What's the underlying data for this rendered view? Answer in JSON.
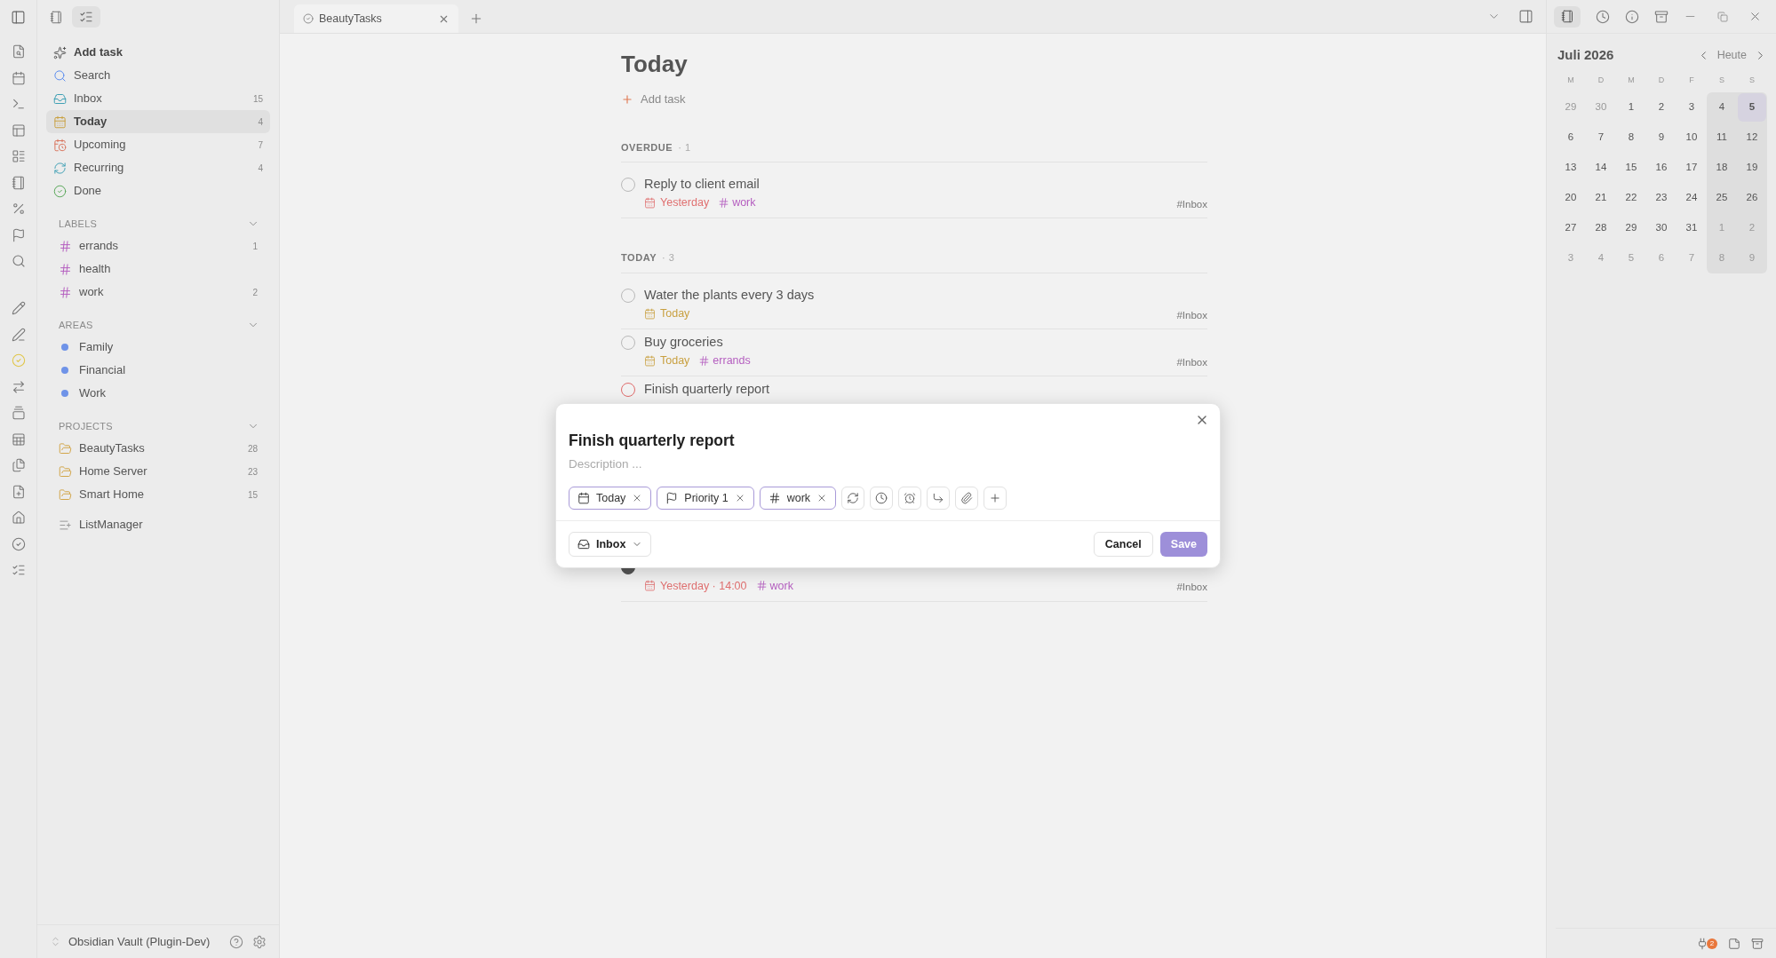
{
  "tab": {
    "title": "BeautyTasks"
  },
  "sidebar": {
    "actions": [
      {
        "label": "Add task",
        "bold": true,
        "selected": false
      },
      {
        "label": "Search",
        "bold": false,
        "selected": false
      },
      {
        "label": "Inbox",
        "count": "15",
        "bold": false,
        "selected": false
      },
      {
        "label": "Today",
        "count": "4",
        "bold": false,
        "selected": true
      },
      {
        "label": "Upcoming",
        "count": "7",
        "bold": false,
        "selected": false
      },
      {
        "label": "Recurring",
        "count": "4",
        "bold": false,
        "selected": false
      },
      {
        "label": "Done",
        "bold": false,
        "selected": false
      }
    ],
    "sections": [
      {
        "title": "LABELS",
        "kind": "label",
        "expanded": true,
        "items": [
          {
            "label": "errands",
            "count": "1"
          },
          {
            "label": "health"
          },
          {
            "label": "work",
            "count": "2"
          }
        ]
      },
      {
        "title": "AREAS",
        "kind": "area",
        "expanded": true,
        "items": [
          {
            "label": "Family"
          },
          {
            "label": "Financial"
          },
          {
            "label": "Work"
          }
        ]
      },
      {
        "title": "PROJECTS",
        "kind": "project",
        "expanded": true,
        "items": [
          {
            "label": "BeautyTasks",
            "count": "28"
          },
          {
            "label": "Home Server",
            "count": "23"
          },
          {
            "label": "Smart Home",
            "count": "15"
          }
        ]
      }
    ],
    "extra": {
      "label": "ListManager"
    },
    "vault": {
      "name": "Obsidian Vault (Plugin-Dev)"
    }
  },
  "page": {
    "title": "Today",
    "add_task": "Add task",
    "groups": [
      {
        "title": "OVERDUE",
        "count": "· 1",
        "tasks": [
          {
            "title": "Reply to client email",
            "date": "Yesterday",
            "overdue": true,
            "tags": [
              "work"
            ],
            "project": "#Inbox",
            "color": "#b9b9b9",
            "filled": false
          }
        ]
      },
      {
        "title": "TODAY",
        "count": "· 3",
        "tasks": [
          {
            "title": "Water the plants every 3 days",
            "date": "Today",
            "overdue": false,
            "project": "#Inbox",
            "color": "#b9b9b9",
            "filled": false
          },
          {
            "title": "Buy groceries",
            "date": "Today",
            "overdue": false,
            "tags": [
              "errands"
            ],
            "project": "#Inbox",
            "color": "#b9b9b9",
            "filled": false
          },
          {
            "title": "Finish quarterly report",
            "color": "#e06c6c",
            "filled": false
          },
          {
            "date": "Yesterday · 14:00",
            "overdue": true,
            "tags": [
              "work"
            ],
            "project": "#Inbox",
            "color": "#555555",
            "filled": true
          }
        ]
      }
    ]
  },
  "modal": {
    "title": "Finish quarterly report",
    "description": {
      "placeholder": "Description ..."
    },
    "chips": [
      {
        "kind": "date",
        "label": "Today"
      },
      {
        "kind": "priority",
        "label": "Priority 1"
      },
      {
        "kind": "label",
        "label": "work"
      }
    ],
    "project": "Inbox",
    "buttons": [
      {
        "label": "Cancel",
        "primary": false
      },
      {
        "label": "Save",
        "primary": true
      }
    ]
  },
  "calendar": {
    "title": "Juli 2026",
    "today": "Heute",
    "weekdays": [
      "M",
      "D",
      "M",
      "D",
      "F",
      "S",
      "S"
    ],
    "weeks": [
      [
        {
          "day": "29",
          "muted": true,
          "selected": false
        },
        {
          "day": "30",
          "muted": true,
          "selected": false
        },
        {
          "day": "1",
          "muted": false,
          "selected": false
        },
        {
          "day": "2",
          "muted": false,
          "selected": false
        },
        {
          "day": "3",
          "muted": false,
          "selected": false
        },
        {
          "day": "4",
          "muted": false,
          "selected": false
        },
        {
          "day": "5",
          "muted": false,
          "selected": true
        }
      ],
      [
        {
          "day": "6",
          "muted": false,
          "selected": false
        },
        {
          "day": "7",
          "muted": false,
          "selected": false
        },
        {
          "day": "8",
          "muted": false,
          "selected": false
        },
        {
          "day": "9",
          "muted": false,
          "selected": false
        },
        {
          "day": "10",
          "muted": false,
          "selected": false
        },
        {
          "day": "11",
          "muted": false,
          "selected": false
        },
        {
          "day": "12",
          "muted": false,
          "selected": false
        }
      ],
      [
        {
          "day": "13",
          "muted": false,
          "selected": false
        },
        {
          "day": "14",
          "muted": false,
          "selected": false
        },
        {
          "day": "15",
          "muted": false,
          "selected": false
        },
        {
          "day": "16",
          "muted": false,
          "selected": false
        },
        {
          "day": "17",
          "muted": false,
          "selected": false
        },
        {
          "day": "18",
          "muted": false,
          "selected": false
        },
        {
          "day": "19",
          "muted": false,
          "selected": false
        }
      ],
      [
        {
          "day": "20",
          "muted": false,
          "selected": false
        },
        {
          "day": "21",
          "muted": false,
          "selected": false
        },
        {
          "day": "22",
          "muted": false,
          "selected": false
        },
        {
          "day": "23",
          "muted": false,
          "selected": false
        },
        {
          "day": "24",
          "muted": false,
          "selected": false
        },
        {
          "day": "25",
          "muted": false,
          "selected": false
        },
        {
          "day": "26",
          "muted": false,
          "selected": false
        }
      ],
      [
        {
          "day": "27",
          "muted": false,
          "selected": false
        },
        {
          "day": "28",
          "muted": false,
          "selected": false
        },
        {
          "day": "29",
          "muted": false,
          "selected": false
        },
        {
          "day": "30",
          "muted": false,
          "selected": false
        },
        {
          "day": "31",
          "muted": false,
          "selected": false
        },
        {
          "day": "1",
          "muted": true,
          "selected": false
        },
        {
          "day": "2",
          "muted": true,
          "selected": false
        }
      ],
      [
        {
          "day": "3",
          "muted": true,
          "selected": false
        },
        {
          "day": "4",
          "muted": true,
          "selected": false
        },
        {
          "day": "5",
          "muted": true,
          "selected": false
        },
        {
          "day": "6",
          "muted": true,
          "selected": false
        },
        {
          "day": "7",
          "muted": true,
          "selected": false
        },
        {
          "day": "8",
          "muted": true,
          "selected": false
        },
        {
          "day": "9",
          "muted": true,
          "selected": false
        }
      ]
    ]
  },
  "status_bar": {
    "badge": "2"
  }
}
